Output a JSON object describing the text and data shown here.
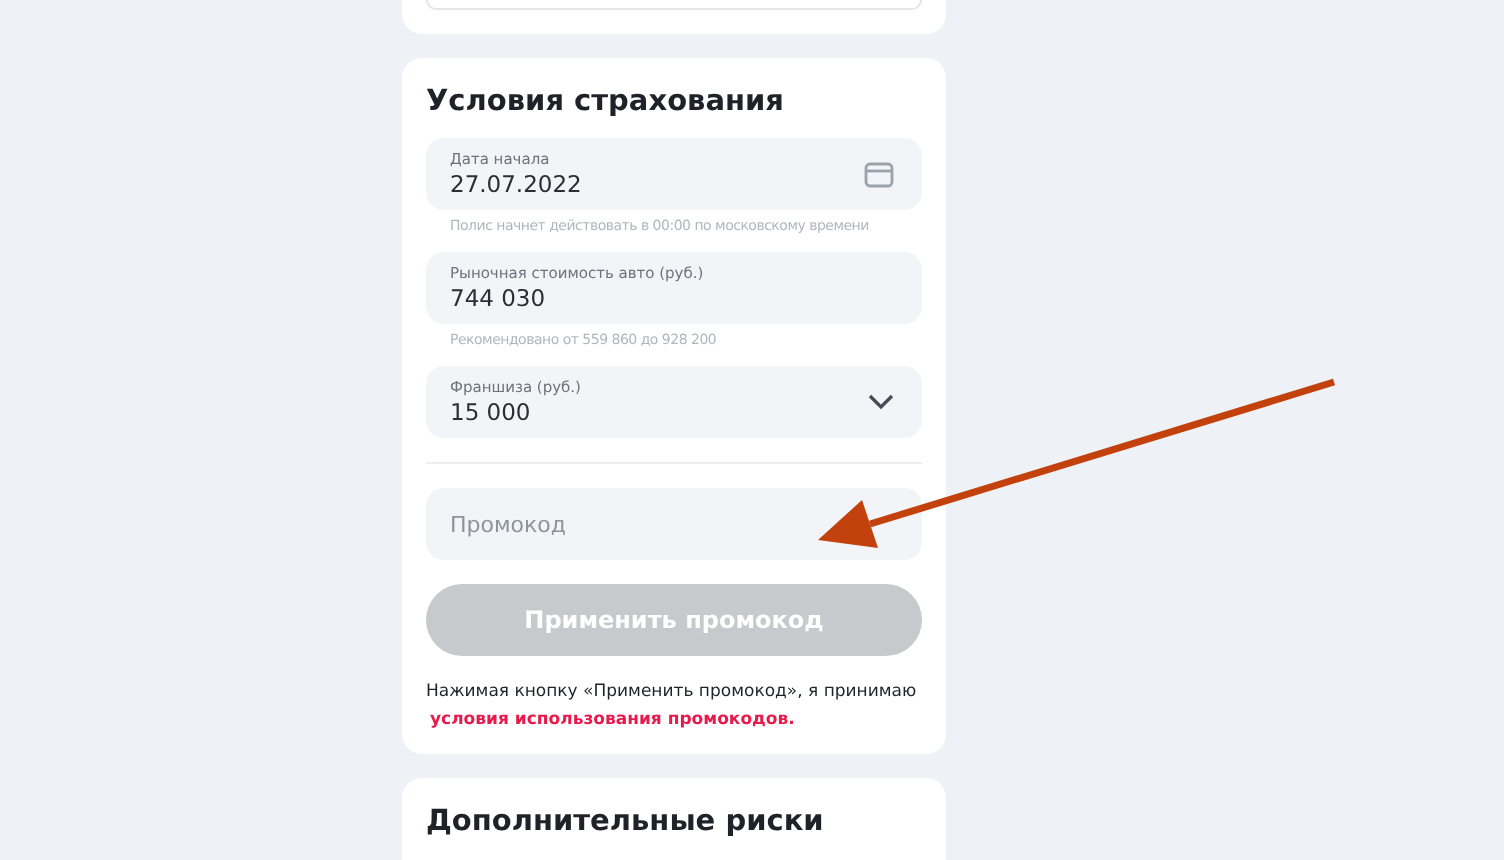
{
  "insurance_terms": {
    "title": "Условия страхования",
    "fields": [
      {
        "kind": "date",
        "label": "Дата начала",
        "value": "27.07.2022",
        "hint": "Полис начнет действовать в 00:00 по московскому времени"
      },
      {
        "kind": "text",
        "label": "Рыночная стоимость авто (руб.)",
        "value": "744 030",
        "hint": "Рекомендовано от 559 860 до 928 200"
      },
      {
        "kind": "select",
        "label": "Франшиза (руб.)",
        "value": "15 000"
      }
    ],
    "promo": {
      "placeholder": "Промокод"
    },
    "apply_button": {
      "label": "Применить промокод",
      "disabled": true
    },
    "consent": {
      "text": "Нажимая кнопку «Применить промокод», я принимаю",
      "link": "условия использования промокодов."
    }
  },
  "extra_risks": {
    "title": "Дополнительные риски"
  }
}
